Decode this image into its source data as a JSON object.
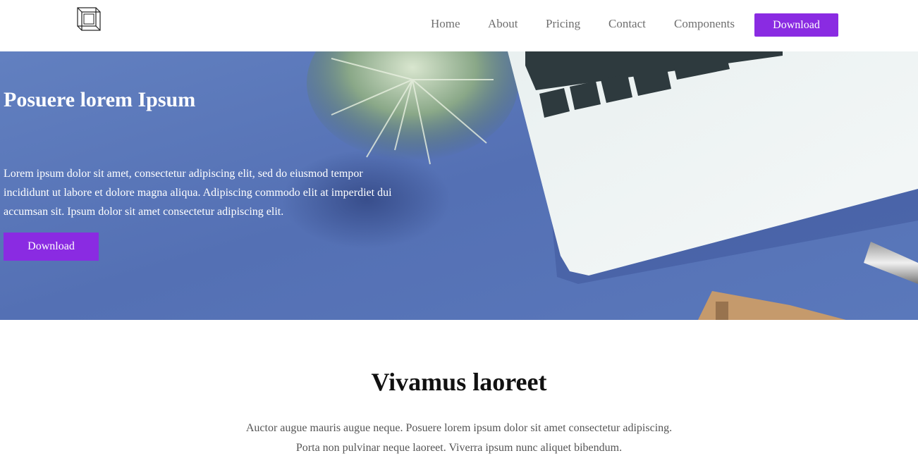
{
  "header": {
    "logo_icon": "cube-logo-icon",
    "nav": [
      {
        "label": "Home"
      },
      {
        "label": "About"
      },
      {
        "label": "Pricing"
      },
      {
        "label": "Contact"
      },
      {
        "label": "Components"
      }
    ],
    "cta_label": "Download"
  },
  "hero": {
    "title": "Posuere lorem Ipsum",
    "text": "Lorem ipsum dolor sit amet, consectetur adipiscing elit, sed do eiusmod tempor incididunt ut labore et dolore magna aliqua. Adipiscing commodo elit at imperdiet dui accumsan sit. Ipsum dolor sit amet consectetur adipiscing elit.",
    "button_label": "Download",
    "background_image": "desk-laptop-plant-photo"
  },
  "section": {
    "title": "Vivamus laoreet",
    "line1": "Auctor augue mauris augue neque. Posuere lorem ipsum dolor sit amet consectetur adipiscing.",
    "line2": "Porta non pulvinar neque laoreet. Viverra ipsum nunc aliquet bibendum."
  },
  "colors": {
    "accent": "#8a2be2",
    "hero_bg": "#5673b6",
    "nav_text": "#6f6f6f"
  }
}
